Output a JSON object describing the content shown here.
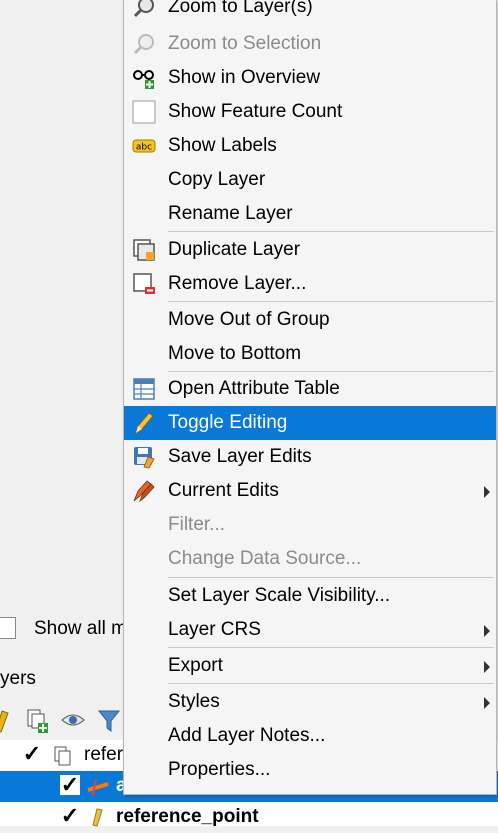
{
  "panel": {
    "show_all_label": "Show all ma",
    "layers_title": "yers",
    "tree": [
      {
        "label": "refer",
        "checked": true,
        "icon": "group-icon"
      },
      {
        "label": "axis",
        "checked": true,
        "icon": "line-layer-icon",
        "selected": true
      },
      {
        "label": "reference_point",
        "checked": true,
        "icon": "point-layer-icon"
      }
    ]
  },
  "menu": {
    "items": [
      {
        "label": "Zoom to Layer(s)",
        "icon": "zoom-layer-icon"
      },
      {
        "label": "Zoom to Selection",
        "icon": "zoom-selection-icon",
        "disabled": true
      },
      {
        "label": "Show in Overview",
        "icon": "overview-icon"
      },
      {
        "label": "Show Feature Count",
        "icon": "checkbox-icon"
      },
      {
        "label": "Show Labels",
        "icon": "labels-icon"
      },
      {
        "label": "Copy Layer"
      },
      {
        "label": "Rename Layer"
      },
      {
        "label": "Duplicate Layer",
        "icon": "duplicate-layer-icon"
      },
      {
        "label": "Remove Layer...",
        "icon": "remove-layer-icon"
      },
      {
        "label": "Move Out of Group"
      },
      {
        "label": "Move to Bottom"
      },
      {
        "label": "Open Attribute Table",
        "icon": "attribute-table-icon"
      },
      {
        "label": "Toggle Editing",
        "icon": "pencil-icon",
        "highlighted": true
      },
      {
        "label": "Save Layer Edits",
        "icon": "save-edits-icon"
      },
      {
        "label": "Current Edits",
        "icon": "current-edits-icon",
        "submenu": true
      },
      {
        "label": "Filter...",
        "disabled": true
      },
      {
        "label": "Change Data Source...",
        "disabled": true
      },
      {
        "label": "Set Layer Scale Visibility..."
      },
      {
        "label": "Layer CRS",
        "submenu": true
      },
      {
        "label": "Export",
        "submenu": true
      },
      {
        "label": "Styles",
        "submenu": true
      },
      {
        "label": "Add Layer Notes..."
      },
      {
        "label": "Properties..."
      }
    ]
  },
  "colors": {
    "highlight": "#0a78d7",
    "menu_bg": "#f5f5f5",
    "disabled_text": "#8b8b8b"
  }
}
